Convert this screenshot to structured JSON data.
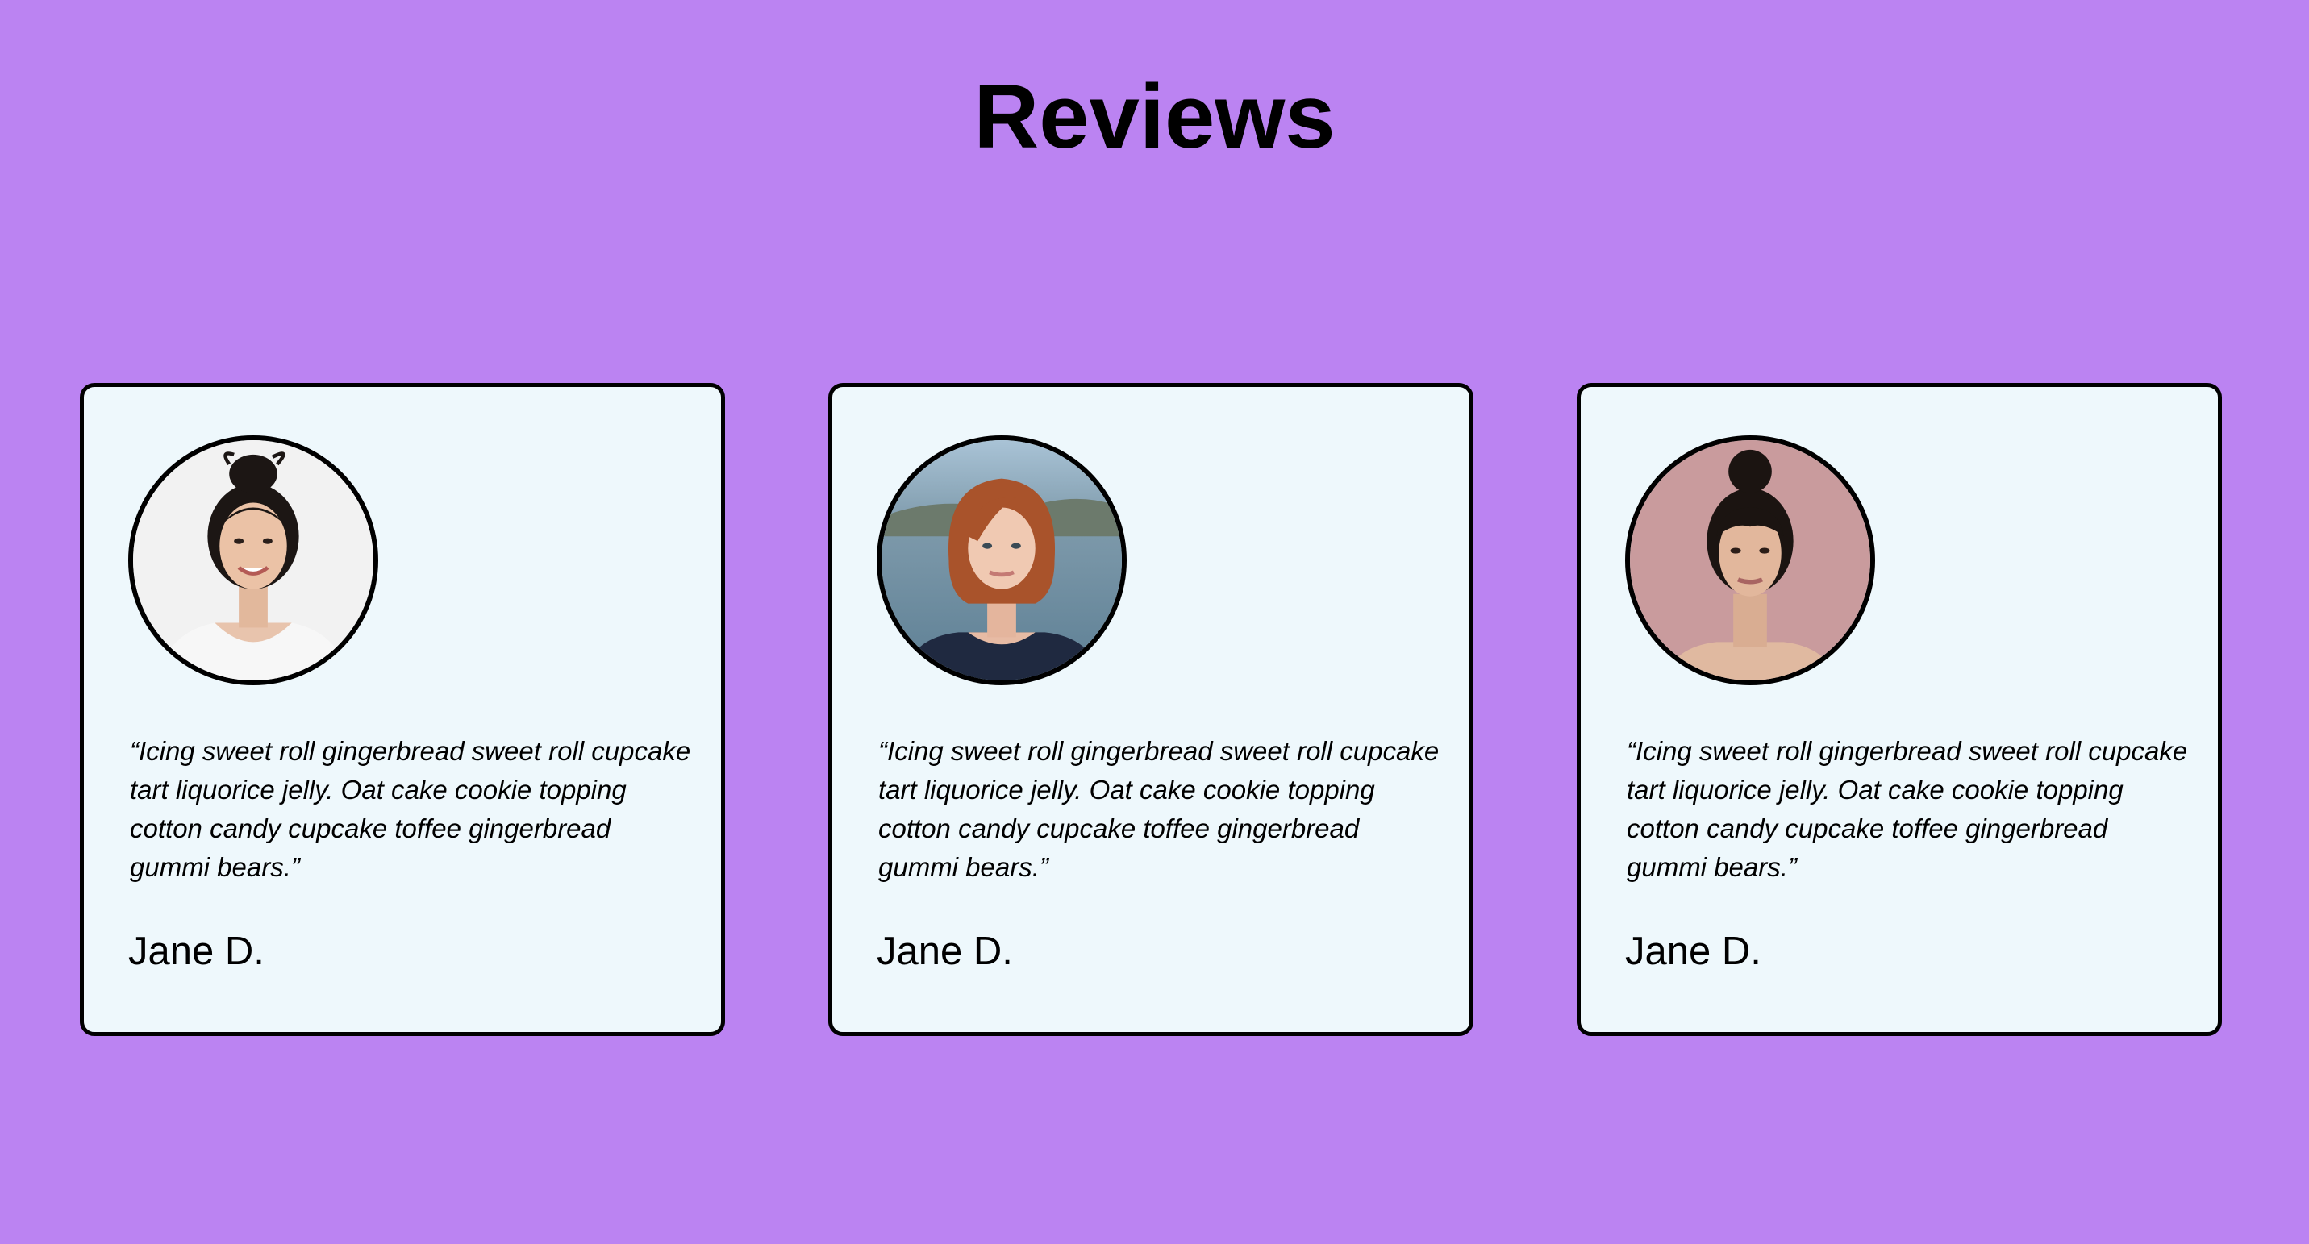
{
  "page": {
    "title": "Reviews",
    "background_color": "#bb83f2",
    "card_color": "#eef8fc"
  },
  "reviews": [
    {
      "quote": "“Icing sweet roll gingerbread sweet roll cupcake tart liquorice jelly. Oat cake cookie topping cotton candy cupcake toffee gingerbread gummi bears.”",
      "author": "Jane D.",
      "avatar": "woman-dark-hair-bun-smiling"
    },
    {
      "quote": "“Icing sweet roll gingerbread sweet roll cupcake tart liquorice jelly. Oat cake cookie topping cotton candy cupcake toffee gingerbread gummi bears.”",
      "author": "Jane D.",
      "avatar": "woman-red-bob-hair-lake"
    },
    {
      "quote": "“Icing sweet roll gingerbread sweet roll cupcake tart liquorice jelly. Oat cake cookie topping cotton candy cupcake toffee gingerbread gummi bears.”",
      "author": "Jane D.",
      "avatar": "woman-dark-hair-bun-pink-background"
    }
  ]
}
